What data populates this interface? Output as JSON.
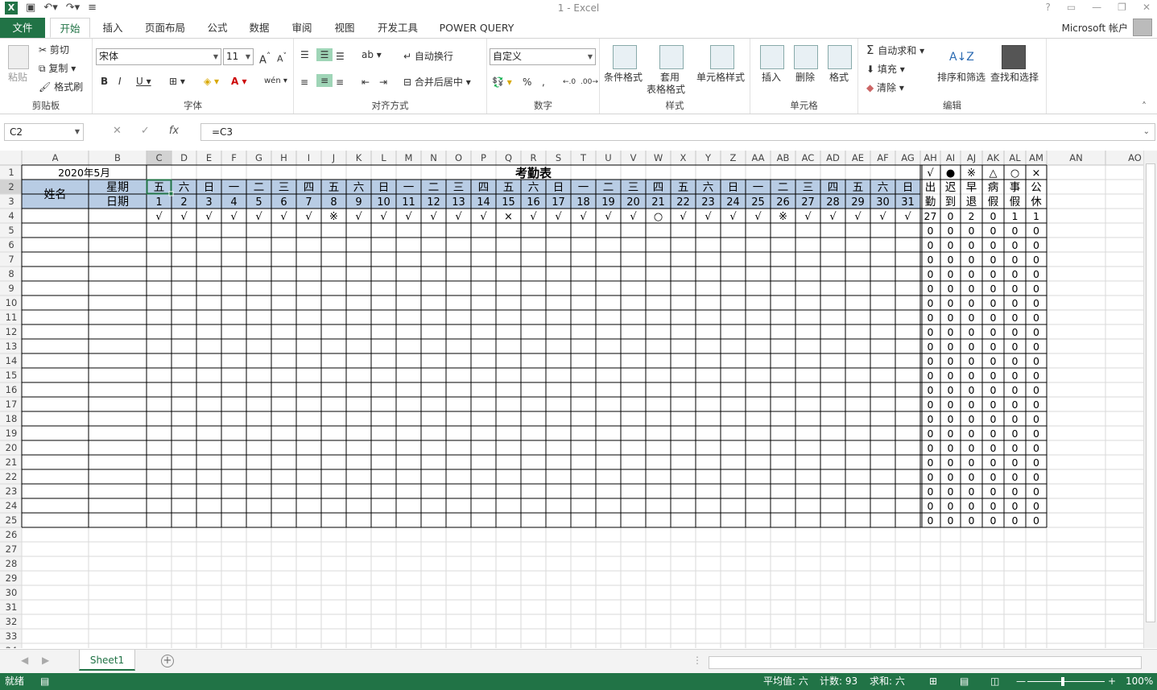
{
  "window": {
    "title": "1 - Excel",
    "account": "Microsoft 帐户"
  },
  "tabs": [
    "文件",
    "开始",
    "插入",
    "页面布局",
    "公式",
    "数据",
    "审阅",
    "视图",
    "开发工具",
    "POWER QUERY"
  ],
  "ribbon": {
    "clipboard": {
      "label": "剪贴板",
      "paste": "粘贴",
      "cut": "剪切",
      "copy": "复制",
      "painter": "格式刷"
    },
    "font": {
      "label": "字体",
      "name": "宋体",
      "size": "11"
    },
    "align": {
      "label": "对齐方式",
      "wrap": "自动换行",
      "merge": "合并后居中"
    },
    "number": {
      "label": "数字",
      "format": "自定义",
      "percent": "%",
      "comma": ","
    },
    "styles": {
      "label": "样式",
      "cond": "条件格式",
      "table1": "套用",
      "table2": "表格格式",
      "cell": "单元格样式"
    },
    "cells": {
      "label": "单元格",
      "insert": "插入",
      "delete": "删除",
      "format": "格式"
    },
    "edit": {
      "label": "编辑",
      "autosum": "自动求和",
      "fill": "填充",
      "clear": "清除",
      "sort": "排序和筛选",
      "find": "查找和选择"
    }
  },
  "formula": {
    "cell": "C2",
    "value": "=C3"
  },
  "sheet": {
    "columns": [
      "A",
      "B",
      "C",
      "D",
      "E",
      "F",
      "G",
      "H",
      "I",
      "J",
      "K",
      "L",
      "M",
      "N",
      "O",
      "P",
      "Q",
      "R",
      "S",
      "T",
      "U",
      "V",
      "W",
      "X",
      "Y",
      "Z",
      "AA",
      "AB",
      "AC",
      "AD",
      "AE",
      "AF",
      "AG",
      "AH",
      "AI",
      "AJ",
      "AK",
      "AL",
      "AM",
      "AN",
      "AO"
    ],
    "rows": [
      "1",
      "2",
      "3",
      "4",
      "5",
      "6",
      "7",
      "8",
      "9",
      "10",
      "11",
      "12",
      "13",
      "14",
      "15",
      "16",
      "17",
      "18",
      "19",
      "20",
      "21",
      "22",
      "23",
      "24",
      "25",
      "26",
      "27",
      "28",
      "29",
      "30",
      "31",
      "32",
      "33",
      "34"
    ],
    "month": "2020年5月",
    "title": "考勤表",
    "name_label": "姓名",
    "week_label": "星期",
    "date_label": "日期",
    "weekdays": [
      "五",
      "六",
      "日",
      "一",
      "二",
      "三",
      "四",
      "五",
      "六",
      "日",
      "一",
      "二",
      "三",
      "四",
      "五",
      "六",
      "日",
      "一",
      "二",
      "三",
      "四",
      "五",
      "六",
      "日",
      "一",
      "二",
      "三",
      "四",
      "五",
      "六",
      "日"
    ],
    "dates": [
      "1",
      "2",
      "3",
      "4",
      "5",
      "6",
      "7",
      "8",
      "9",
      "10",
      "11",
      "12",
      "13",
      "14",
      "15",
      "16",
      "17",
      "18",
      "19",
      "20",
      "21",
      "22",
      "23",
      "24",
      "25",
      "26",
      "27",
      "28",
      "29",
      "30",
      "31"
    ],
    "row4_marks": [
      "√",
      "√",
      "√",
      "√",
      "√",
      "√",
      "√",
      "※",
      "√",
      "√",
      "√",
      "√",
      "√",
      "√",
      "×",
      "√",
      "√",
      "√",
      "√",
      "√",
      "○",
      "√",
      "√",
      "√",
      "√",
      "※",
      "√",
      "√",
      "√",
      "√",
      "√"
    ],
    "summary_symbols": [
      "√",
      "●",
      "※",
      "△",
      "○",
      "×"
    ],
    "summary_top": [
      "出",
      "迟",
      "早",
      "病",
      "事",
      "公"
    ],
    "summary_bottom": [
      "勤",
      "到",
      "退",
      "假",
      "假",
      "休"
    ],
    "row4_counts": [
      "27",
      "0",
      "2",
      "0",
      "1",
      "1"
    ],
    "empty_count": "0"
  },
  "sheet_tab": "Sheet1",
  "status": {
    "mode": "就绪",
    "average": "平均值: 六",
    "count": "计数: 93",
    "sum": "求和: 六",
    "zoom": "100%"
  }
}
